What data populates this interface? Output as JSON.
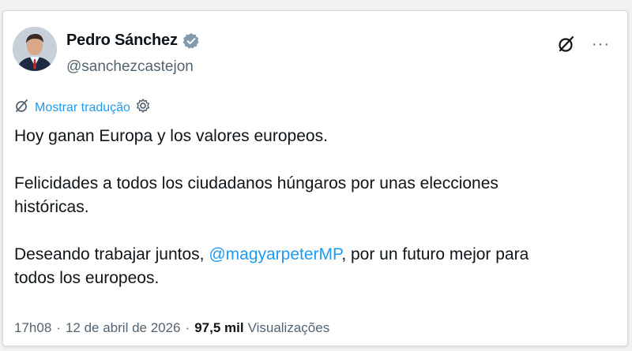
{
  "author": {
    "name": "Pedro Sánchez",
    "handle": "@sanchezcastejon",
    "verified": true
  },
  "actions": {
    "grok_icon": "grok-slash-circle-icon",
    "more_icon": "more-horizontal-icon",
    "more_label": "···"
  },
  "translate": {
    "label": "Mostrar tradução",
    "icon": "translate-globe-icon",
    "settings_icon": "gear-icon"
  },
  "tweet": {
    "line1": "Hoy ganan Europa y los valores europeos.",
    "line2": "Felicidades a todos los ciudadanos húngaros por unas elecciones",
    "line3": "históricas.",
    "line4_prefix": "Deseando trabajar juntos, ",
    "mention": "@magyarpeterMP",
    "line4_suffix": ", por un futuro mejor para",
    "line5": "todos los europeos."
  },
  "meta": {
    "time": "17h08",
    "separator": "·",
    "date": "12 de abril de 2026",
    "views_count": "97,5 mil",
    "views_label": "Visualizações"
  },
  "colors": {
    "accent": "#1d9bf0",
    "text_primary": "#0f1419",
    "text_secondary": "#536471"
  }
}
